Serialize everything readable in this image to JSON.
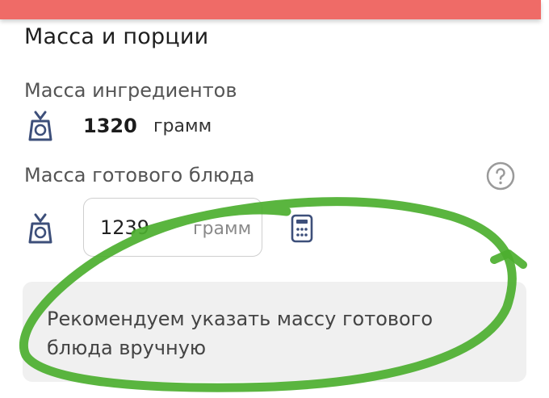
{
  "section": {
    "title": "Масса и порции"
  },
  "ingredients": {
    "label": "Масса ингредиентов",
    "value": "1320",
    "unit": "грамм",
    "icon": "scale-icon"
  },
  "final_dish": {
    "label": "Масса готового блюда",
    "help_icon": "question-circle-icon",
    "input_value": "1239",
    "unit": "грамм",
    "calculator_icon": "calculator-icon"
  },
  "hint": {
    "text": "Рекомендуем указать массу готового блюда вручную"
  },
  "colors": {
    "top_bar": "#ef6b67",
    "annotation_stroke": "#4caf2f",
    "hint_background": "#f0f0f0"
  }
}
